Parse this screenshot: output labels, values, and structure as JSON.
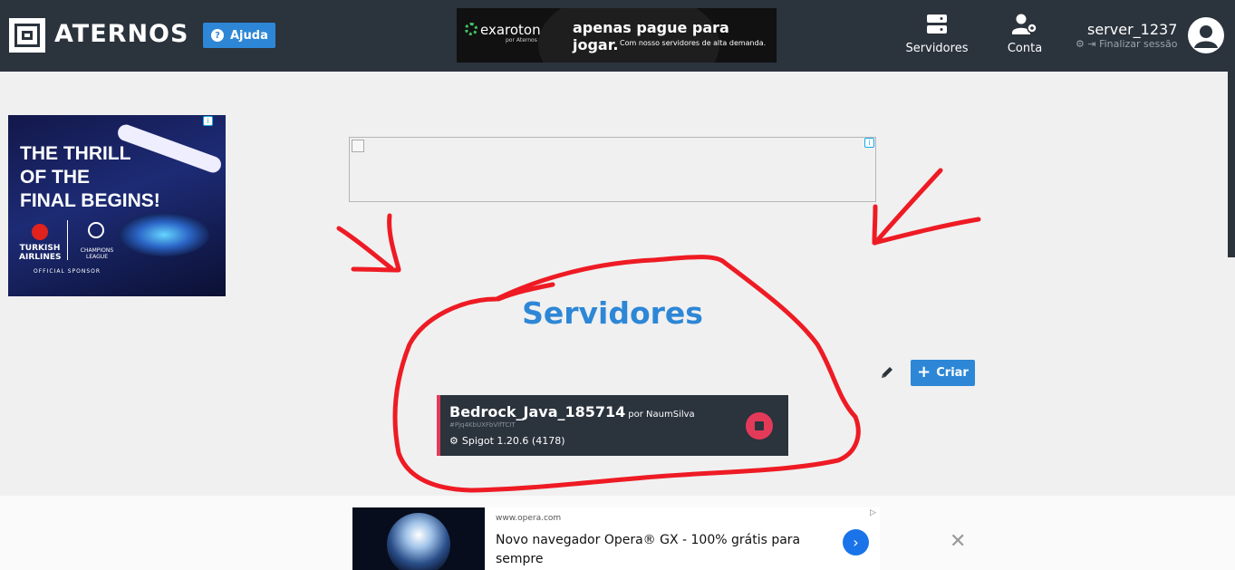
{
  "header": {
    "brand": "ATERNOS",
    "help_label": "Ajuda",
    "nav": [
      {
        "label": "Servidores",
        "icon": "server-icon"
      },
      {
        "label": "Conta",
        "icon": "account-settings-icon"
      }
    ],
    "user": {
      "name": "server_1237",
      "logout_label": "Finalizar sessão"
    }
  },
  "top_ad": {
    "brand": "exaroton",
    "brand_sub": "por Aternos",
    "headline": "apenas pague para jogar.",
    "subline": "Com nosso servidores de alta demanda."
  },
  "left_ad": {
    "headline_lines": [
      "THE THRILL",
      "OF THE",
      "FINAL BEGINS!"
    ],
    "airline": "TURKISH AIRLINES",
    "league": "CHAMPIONS LEAGUE",
    "sponsor": "OFFICIAL SPONSOR"
  },
  "main": {
    "title": "Servidores",
    "create_label": "Criar"
  },
  "servers": [
    {
      "name": "Bedrock_Java_185714",
      "owner": "por NaumSilva",
      "id": "#Pjq4KbUXFbVlfTCIT",
      "software": "Spigot 1.20.6 (4178)",
      "status": "online"
    }
  ],
  "bottom_ad": {
    "url": "www.opera.com",
    "title": "Novo navegador Opera® GX - 100% grátis para sempre"
  },
  "colors": {
    "header_bg": "#2b333d",
    "accent": "#2d87d6",
    "status_online": "#e43a5a",
    "annotation": "#ee1b24"
  }
}
